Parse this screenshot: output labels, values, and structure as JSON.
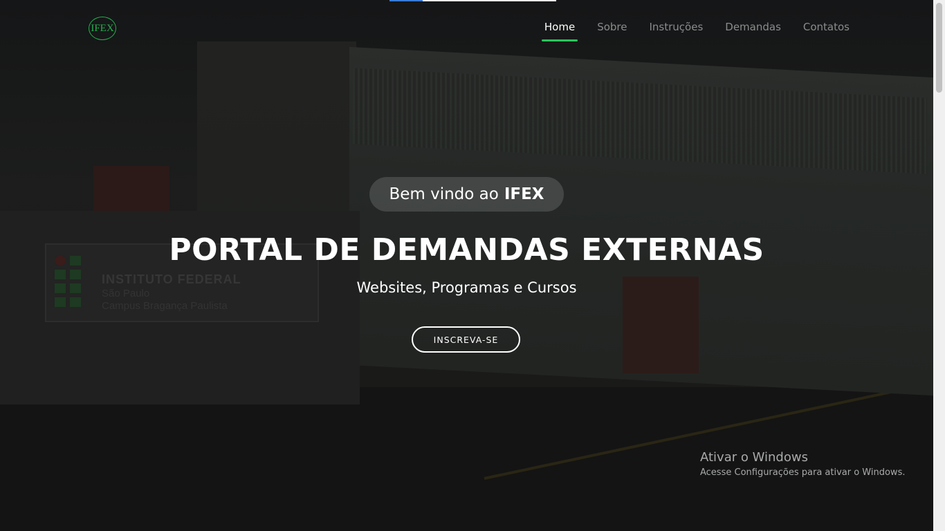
{
  "loading_progress": 0.2,
  "brand": {
    "logo_text": "IFEX",
    "accent": "#28c55c"
  },
  "nav": {
    "items": [
      {
        "label": "Home",
        "active": true
      },
      {
        "label": "Sobre",
        "active": false
      },
      {
        "label": "Instruções",
        "active": false
      },
      {
        "label": "Demandas",
        "active": false
      },
      {
        "label": "Contatos",
        "active": false
      }
    ]
  },
  "hero": {
    "welcome_prefix": "Bem vindo ao",
    "welcome_brand": "IFEX",
    "title": "PORTAL DE DEMANDAS EXTERNAS",
    "subtitle": "Websites, Programas e Cursos",
    "cta_label": "INSCREVA-SE"
  },
  "background_sign": {
    "line1": "INSTITUTO FEDERAL",
    "line2": "São Paulo",
    "line3": "Campus Bragança Paulista"
  },
  "windows_watermark": {
    "title": "Ativar o Windows",
    "subtitle": "Acesse Configurações para ativar o Windows."
  }
}
